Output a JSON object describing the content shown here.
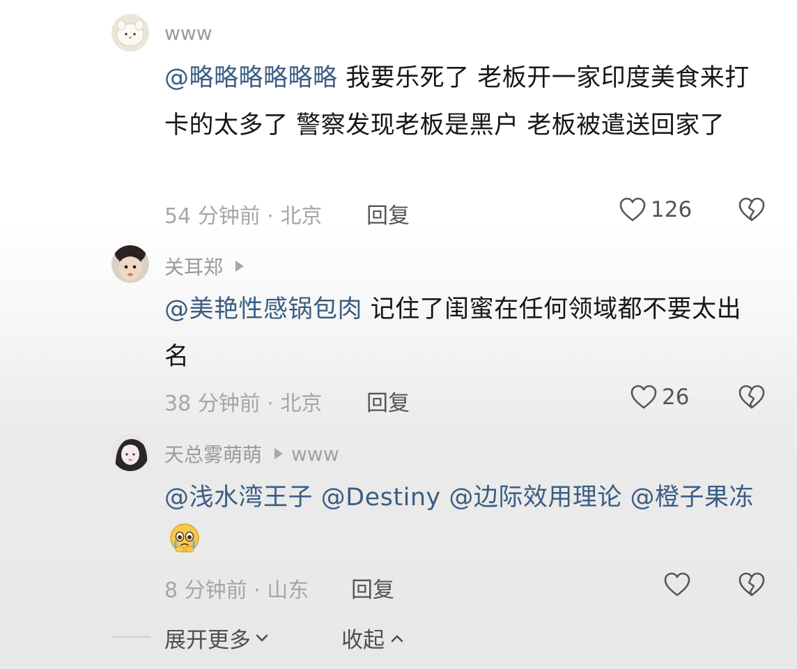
{
  "comments": [
    {
      "username": "www",
      "mention": "@略略略略略略",
      "text": " 我要乐死了 老板开一家印度美食来打卡的太多了 警察发现老板是黑户 老板被遣送回家了",
      "time_location": "54 分钟前 · 北京",
      "reply_label": "回复",
      "likes": "126"
    },
    {
      "username": "关耳郑",
      "mention": "@美艳性感锅包肉",
      "text": " 记住了闺蜜在任何领域都不要太出名",
      "time_location": "38 分钟前 · 北京",
      "reply_label": "回复",
      "likes": "26"
    },
    {
      "username": "天总雾萌萌",
      "reply_to": "www",
      "mentions": [
        "@浅水湾王子",
        "@Destiny",
        "@边际效用理论",
        "@橙子果冻"
      ],
      "emoji": "crying-pleading-emoji",
      "time_location": "8 分钟前 · 山东",
      "reply_label": "回复",
      "likes": ""
    }
  ],
  "footer": {
    "expand_label": "展开更多",
    "collapse_label": "收起"
  },
  "colors": {
    "mention": "#3a5d83",
    "meta": "#a6a6a6",
    "body": "#161616"
  },
  "icons": [
    "heart-icon",
    "broken-heart-icon",
    "play-icon",
    "chevron-down-icon",
    "chevron-up-icon"
  ]
}
